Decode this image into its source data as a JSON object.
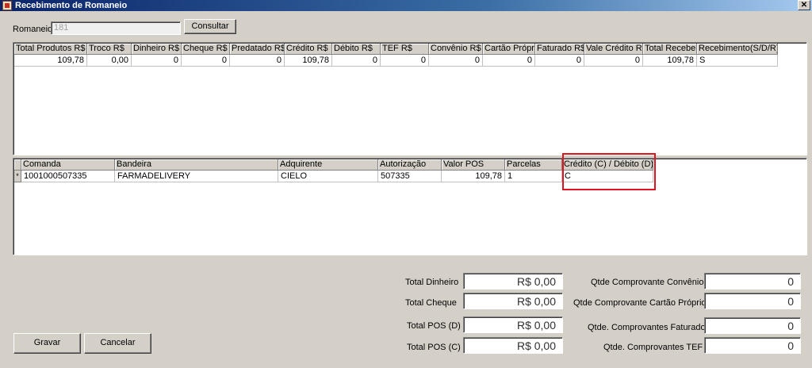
{
  "window": {
    "title": "Recebimento de Romaneio",
    "close_glyph": "✕"
  },
  "romaneio": {
    "label": "Romaneio",
    "value": "181",
    "consultar_label": "Consultar"
  },
  "summary_table": {
    "columns": [
      "Total Produtos R$",
      "Troco R$",
      "Dinheiro R$",
      "Cheque R$",
      "Predatado R$",
      "Crédito R$",
      "Débito R$",
      "TEF R$",
      "Convênio R$",
      "Cartão Próprio",
      "Faturado R$",
      "Vale Crédito R$",
      "Total Receber",
      "Recebimento(S/D/R)"
    ],
    "rows": [
      [
        "109,78",
        "0,00",
        "0",
        "0",
        "0",
        "109,78",
        "0",
        "0",
        "0",
        "0",
        "0",
        "0",
        "109,78",
        "S"
      ]
    ]
  },
  "payment_table": {
    "columns": [
      "Comanda",
      "Bandeira",
      "Adquirente",
      "Autorização",
      "Valor POS",
      "Parcelas",
      "Crédito (C) / Débito (D)"
    ],
    "rows": [
      {
        "indicator": "*",
        "cells": [
          "1001000507335",
          "FARMADELIVERY",
          "CIELO",
          "507335",
          "109,78",
          "1",
          "C"
        ]
      }
    ]
  },
  "totals": {
    "dinheiro_label": "Total Dinheiro",
    "dinheiro_value": "R$ 0,00",
    "cheque_label": "Total Cheque",
    "cheque_value": "R$ 0,00",
    "pos_d_label": "Total POS (D)",
    "pos_d_value": "R$ 0,00",
    "pos_c_label": "Total POS (C)",
    "pos_c_value": "R$ 0,00"
  },
  "counts": {
    "convenio_label": "Qtde Comprovante Convênio",
    "convenio_value": "0",
    "cartao_label": "Qtde Comprovante Cartão Próprio",
    "cartao_value": "0",
    "faturado_label": "Qtde. Comprovantes Faturado",
    "faturado_value": "0",
    "tef_label": "Qtde. Comprovantes TEF",
    "tef_value": "0"
  },
  "actions": {
    "gravar_label": "Gravar",
    "cancelar_label": "Cancelar"
  },
  "highlight_color": "#e0141e"
}
